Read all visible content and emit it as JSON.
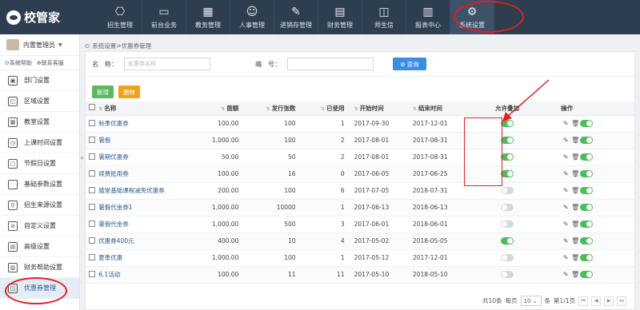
{
  "app": {
    "logo_text": "校管家"
  },
  "nav": [
    {
      "label": "招生管理",
      "icon": "person-badge-icon"
    },
    {
      "label": "前台业务",
      "icon": "monitor-icon"
    },
    {
      "label": "教务管理",
      "icon": "calendar-icon"
    },
    {
      "label": "人事管理",
      "icon": "people-icon"
    },
    {
      "label": "进销存管理",
      "icon": "edit-icon"
    },
    {
      "label": "财务管理",
      "icon": "money-icon"
    },
    {
      "label": "师生信",
      "icon": "chat-icon"
    },
    {
      "label": "报表中心",
      "icon": "chart-icon"
    },
    {
      "label": "系统设置",
      "icon": "gear-icon"
    }
  ],
  "user": {
    "name": "内置管理员",
    "help": "系统帮助",
    "contact": "联系客服"
  },
  "sidebar": {
    "items": [
      {
        "label": "部门设置",
        "icon": "dept-icon"
      },
      {
        "label": "区域设置",
        "icon": "region-icon"
      },
      {
        "label": "教室设置",
        "icon": "classroom-icon"
      },
      {
        "label": "上课时间设置",
        "icon": "clock-icon"
      },
      {
        "label": "节假日设置",
        "icon": "holiday-icon"
      },
      {
        "label": "基础参数设置",
        "icon": "sliders-icon"
      },
      {
        "label": "招生来源设置",
        "icon": "source-icon"
      },
      {
        "label": "自定义设置",
        "icon": "custom-icon"
      },
      {
        "label": "高级设置",
        "icon": "advanced-icon"
      },
      {
        "label": "财务帮助设置",
        "icon": "finance-icon"
      },
      {
        "label": "优惠券管理",
        "icon": "coupon-icon"
      }
    ]
  },
  "breadcrumb": "系统设置>优惠券管理",
  "search": {
    "name_label": "名　称：",
    "name_placeholder": "优惠券名称",
    "code_label": "编　号：",
    "button": "查询"
  },
  "actions": {
    "add": "新增",
    "delete": "删除"
  },
  "table": {
    "headers": [
      "名称",
      "面额",
      "发行张数",
      "已使用",
      "开始时间",
      "结束时间",
      "允许叠加",
      "操作"
    ],
    "rows": [
      {
        "name": "秋季优惠券",
        "face": "100.00",
        "issued": "100",
        "used": "1",
        "start": "2017-09-30",
        "end": "2017-12-01",
        "stack": true,
        "enabled": true
      },
      {
        "name": "暑假",
        "face": "1,000.00",
        "issued": "100",
        "used": "2",
        "start": "2017-08-01",
        "end": "2017-08-31",
        "stack": true,
        "enabled": true
      },
      {
        "name": "暑期优惠券",
        "face": "50.00",
        "issued": "50",
        "used": "2",
        "start": "2017-08-01",
        "end": "2017-08-31",
        "stack": true,
        "enabled": true
      },
      {
        "name": "续费抵用券",
        "face": "100.00",
        "issued": "16",
        "used": "0",
        "start": "2017-06-05",
        "end": "2017-06-25",
        "stack": true,
        "enabled": true
      },
      {
        "name": "随堂基础课程减免优惠券",
        "face": "200.00",
        "issued": "100",
        "used": "6",
        "start": "2017-07-05",
        "end": "2018-07-31",
        "stack": false,
        "enabled": true
      },
      {
        "name": "暑假代金券1",
        "face": "1,000.00",
        "issued": "10000",
        "used": "1",
        "start": "2017-06-13",
        "end": "2018-06-13",
        "stack": false,
        "enabled": true
      },
      {
        "name": "暑假代金券",
        "face": "1,000.00",
        "issued": "500",
        "used": "3",
        "start": "2017-06-01",
        "end": "2018-06-01",
        "stack": false,
        "enabled": true
      },
      {
        "name": "优惠券400元",
        "face": "400.00",
        "issued": "10",
        "used": "4",
        "start": "2017-05-02",
        "end": "2018-05-05",
        "stack": true,
        "enabled": true
      },
      {
        "name": "夏季优惠",
        "face": "1,000.00",
        "issued": "100",
        "used": "1",
        "start": "2017-05-12",
        "end": "2017-12-01",
        "stack": false,
        "enabled": true
      },
      {
        "name": "6.1活动",
        "face": "100.00",
        "issued": "11",
        "used": "11",
        "start": "2017-05-10",
        "end": "2018-05-10",
        "stack": false,
        "enabled": true
      }
    ]
  },
  "pager": {
    "total": "共10条",
    "per_page_label": "每页",
    "per_page": "10",
    "unit": "条",
    "page_info": "第1/1页"
  },
  "colors": {
    "nav_bg": "#2d3e50",
    "accent": "#3a8ee6",
    "toggle_on": "#4cbd5a",
    "highlight": "#e02020"
  }
}
